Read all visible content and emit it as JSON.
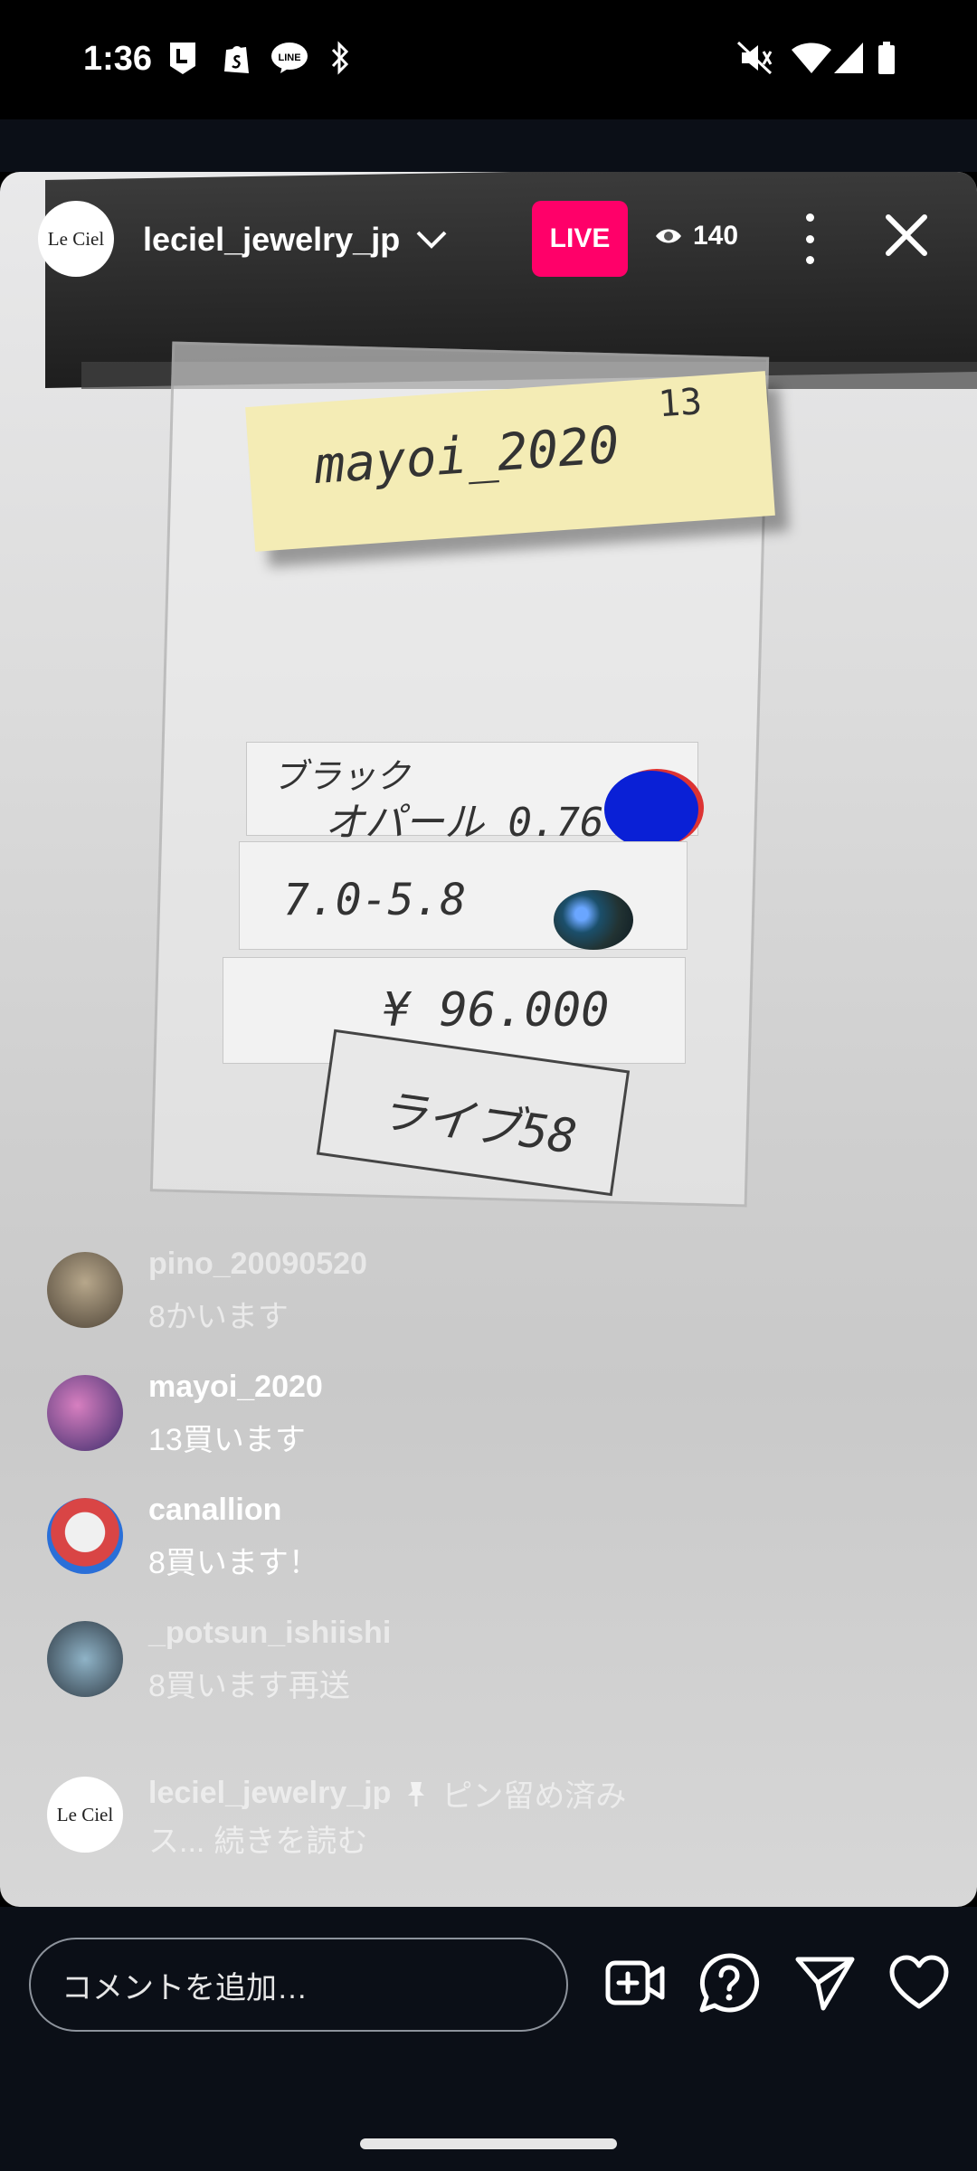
{
  "status_bar": {
    "time": "1:36",
    "left_icons": [
      "line-l-icon",
      "shopify-icon",
      "line-chat-icon",
      "bluetooth-icon"
    ],
    "line_badge_text": "LINE",
    "right_icons": [
      "mute-icon",
      "wifi-icon",
      "signal-icon",
      "battery-icon"
    ]
  },
  "live_header": {
    "avatar_text": "Le Ciel",
    "username": "leciel_jewelry_jp",
    "live_label": "LIVE",
    "viewer_count": "140",
    "accent_color": "#ff0069"
  },
  "video_scene": {
    "sticky_name": "mayoi_2020",
    "sticky_number": "13",
    "label_line1": "ブラック",
    "label_line2": "オパール 0.76",
    "label_size": "7.0-5.8",
    "label_price": "¥ 96.000",
    "label_live": "ライブ58"
  },
  "comments": [
    {
      "user": "pino_20090520",
      "text": "8かいます",
      "avatar_color": "#6b5a47",
      "faded": true
    },
    {
      "user": "mayoi_2020",
      "text": "13買います",
      "avatar_color": "#7a3f8f",
      "faded": false
    },
    {
      "user": "canallion",
      "text": "8買います！",
      "avatar_color": "#c94848",
      "faded": false
    },
    {
      "user": "_potsun_ishiishi",
      "text": "8買います再送",
      "avatar_color": "#3c4a57",
      "faded": true
    }
  ],
  "pinned": {
    "user": "leciel_jewelry_jp",
    "avatar_text": "Le Ciel",
    "pinned_label": "ピン留め済み",
    "preview": "ス...",
    "read_more": "続きを読む"
  },
  "input_bar": {
    "placeholder": "コメントを追加…",
    "icons": [
      "add-video-icon",
      "question-icon",
      "send-icon",
      "heart-icon"
    ]
  }
}
